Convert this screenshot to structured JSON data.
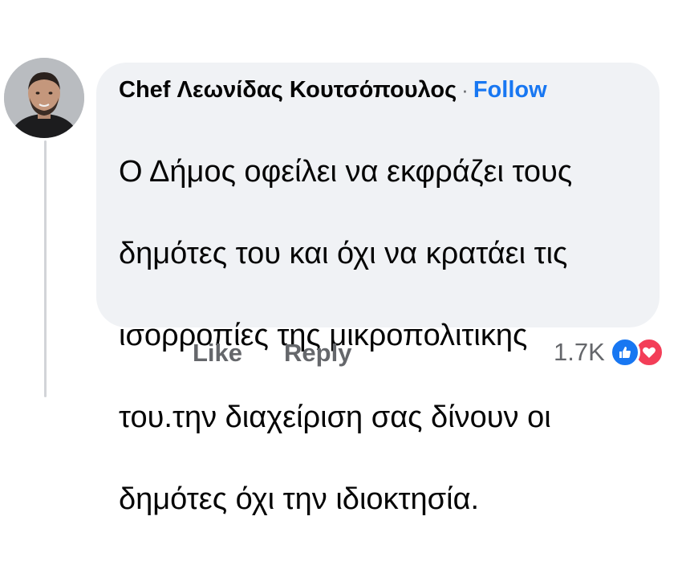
{
  "comment": {
    "author": "Chef Λεωνίδας Κουτσόπουλος",
    "separator": "·",
    "follow_label": "Follow",
    "text_lines": [
      "Ο Δήμος οφείλει να εκφράζει τους",
      "δημότες του και όχι να κρατάει τις",
      "ισορροπίες της μικροπολιτικης",
      "του.την διαχείριση σας δίνουν οι",
      "δημότες όχι την ιδιοκτησία."
    ]
  },
  "actions": {
    "like_label": "Like",
    "reply_label": "Reply"
  },
  "reactions": {
    "count": "1.7K",
    "types": [
      "like-icon",
      "love-icon"
    ],
    "colors": {
      "like": "#1877f2",
      "love": "#f33e58"
    }
  },
  "colors": {
    "bubble": "#f0f2f5",
    "link": "#1877f2",
    "muted": "#65676b"
  }
}
